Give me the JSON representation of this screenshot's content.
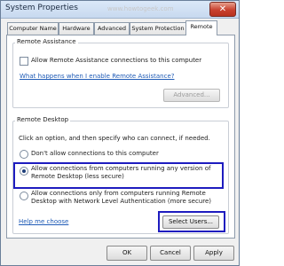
{
  "window": {
    "title": "System Properties",
    "close_label": "✕"
  },
  "watermark": "www.howtogeek.com",
  "tabs": [
    {
      "label": "Computer Name",
      "active": false
    },
    {
      "label": "Hardware",
      "active": false
    },
    {
      "label": "Advanced",
      "active": false
    },
    {
      "label": "System Protection",
      "active": false
    },
    {
      "label": "Remote",
      "active": true
    }
  ],
  "remote_assistance": {
    "heading": "Remote Assistance",
    "checkbox_label": "Allow Remote Assistance connections to this computer",
    "checked": false,
    "help_link": "What happens when I enable Remote Assistance?",
    "advanced_button": "Advanced..."
  },
  "remote_desktop": {
    "heading": "Remote Desktop",
    "instruction": "Click an option, and then specify who can connect, if needed.",
    "options": [
      {
        "label": "Don't allow connections to this computer",
        "selected": false
      },
      {
        "label": "Allow connections from computers running any version of Remote Desktop (less secure)",
        "selected": true
      },
      {
        "label": "Allow connections only from computers running Remote Desktop with Network Level Authentication (more secure)",
        "selected": false
      }
    ],
    "help_link": "Help me choose",
    "select_users_button": "Select Users..."
  },
  "footer": {
    "ok": "OK",
    "cancel": "Cancel",
    "apply": "Apply"
  },
  "colors": {
    "highlight": "#1e1cbf",
    "link": "#1f5bb6",
    "close": "#c8402e"
  }
}
